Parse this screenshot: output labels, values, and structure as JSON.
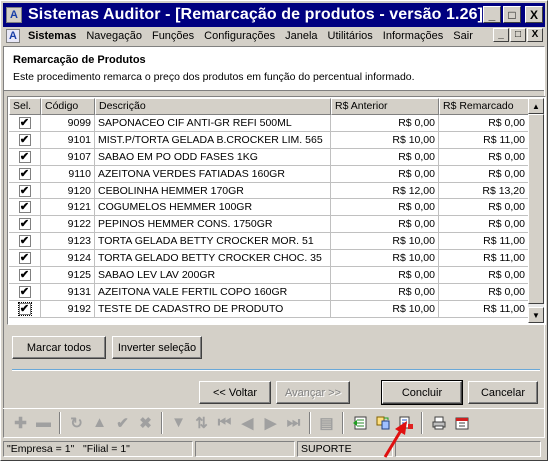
{
  "window": {
    "title": "Sistemas Auditor - [Remarcação de produtos - versão 1.26]",
    "app_icon_letter": "A",
    "controls": [
      "_",
      "□",
      "X"
    ]
  },
  "menubar": {
    "items": [
      "Sistemas",
      "Navegação",
      "Funções",
      "Configurações",
      "Janela",
      "Utilitários",
      "Informações",
      "Sair"
    ],
    "mdi_controls": [
      "_",
      "□",
      "X"
    ]
  },
  "header": {
    "title": "Remarcação de Produtos",
    "description": "Este procedimento remarca o preço dos produtos em função do percentual informado."
  },
  "grid": {
    "columns": [
      "Sel.",
      "Código",
      "Descrição",
      "R$ Anterior",
      "R$ Remarcado"
    ],
    "rows": [
      {
        "checked": true,
        "codigo": "9099",
        "descricao": "SAPONACEO CIF ANTI-GR REFI        500ML",
        "anterior": "R$ 0,00",
        "remarcado": "R$ 0,00"
      },
      {
        "checked": true,
        "codigo": "9101",
        "descricao": "MIST.P/TORTA GELADA B.CROCKER LIM. 565",
        "anterior": "R$ 10,00",
        "remarcado": "R$ 11,00"
      },
      {
        "checked": true,
        "codigo": "9107",
        "descricao": "SABAO EM PO ODD FASES               1KG",
        "anterior": "R$ 0,00",
        "remarcado": "R$ 0,00"
      },
      {
        "checked": true,
        "codigo": "9110",
        "descricao": "AZEITONA VERDES FATIADAS          160GR",
        "anterior": "R$ 0,00",
        "remarcado": "R$ 0,00"
      },
      {
        "checked": true,
        "codigo": "9120",
        "descricao": "CEBOLINHA HEMMER               170GR",
        "anterior": "R$ 12,00",
        "remarcado": "R$ 13,20"
      },
      {
        "checked": true,
        "codigo": "9121",
        "descricao": "COGUMELOS HEMMER              100GR",
        "anterior": "R$ 0,00",
        "remarcado": "R$ 0,00"
      },
      {
        "checked": true,
        "codigo": "9122",
        "descricao": "PEPINOS HEMMER CONS.          1750GR",
        "anterior": "R$ 0,00",
        "remarcado": "R$ 0,00"
      },
      {
        "checked": true,
        "codigo": "9123",
        "descricao": "TORTA GELADA BETTY CROCKER MOR.    51",
        "anterior": "R$ 10,00",
        "remarcado": "R$ 11,00"
      },
      {
        "checked": true,
        "codigo": "9124",
        "descricao": "TORTA GELADO BETTY CROCKER CHOC.   35",
        "anterior": "R$ 10,00",
        "remarcado": "R$ 11,00"
      },
      {
        "checked": true,
        "codigo": "9125",
        "descricao": "SABAO LEV LAV               200GR",
        "anterior": "R$ 0,00",
        "remarcado": "R$ 0,00"
      },
      {
        "checked": true,
        "codigo": "9131",
        "descricao": "AZEITONA VALE FERTIL COPO       160GR",
        "anterior": "R$ 0,00",
        "remarcado": "R$ 0,00"
      },
      {
        "checked": true,
        "codigo": "9192",
        "descricao": "TESTE DE CADASTRO DE PRODUTO",
        "anterior": "R$ 10,00",
        "remarcado": "R$ 11,00"
      }
    ]
  },
  "buttons": {
    "marcar_todos": "Marcar todos",
    "inverter_selecao": "Inverter seleção",
    "voltar": "<< Voltar",
    "avancar": "Avançar >>",
    "concluir": "Concluir",
    "cancelar": "Cancelar"
  },
  "toolbar": {
    "icons": [
      "plus-icon",
      "minus-icon",
      "refresh-icon",
      "up-triangle-icon",
      "check-icon",
      "x-icon",
      "filter-icon",
      "sort-icon",
      "first-icon",
      "prev-icon",
      "next-icon",
      "last-icon",
      "document-icon",
      "export-green-icon",
      "transfer-icon",
      "list-icon",
      "print-icon",
      "calendar-icon"
    ]
  },
  "statusbar": {
    "empresa": "\"Empresa = 1\"",
    "filial": "\"Filial = 1\"",
    "user": "SUPORTE"
  },
  "colors": {
    "titlebar": "#000080",
    "face": "#d4d0c8",
    "divider": "#6aa8d8",
    "arrow": "#e01010"
  }
}
